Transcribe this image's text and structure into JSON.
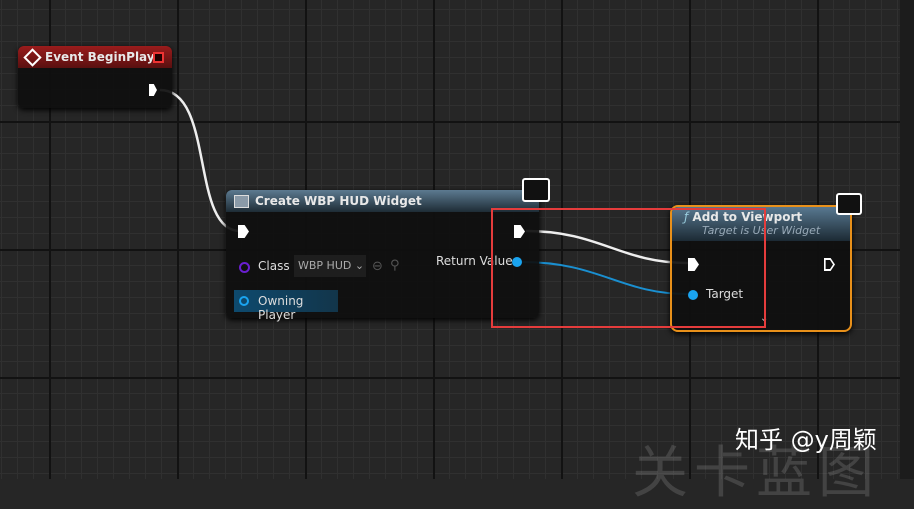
{
  "nodes": {
    "begin_play": {
      "title": "Event BeginPlay"
    },
    "create_widget": {
      "title": "Create WBP HUD Widget",
      "class_label": "Class",
      "class_value": "WBP HUD",
      "owning_player": "Owning Player",
      "return_value": "Return Value"
    },
    "add_viewport": {
      "title": "Add to Viewport",
      "subtitle": "Target is User Widget",
      "target": "Target"
    }
  },
  "watermark": {
    "text": "知乎 @y周颖",
    "background_text": "关卡蓝图"
  },
  "colors": {
    "event_header": "#8c1a1a",
    "function_header": "#3d5a6e",
    "object_pin": "#1aa4f0",
    "class_pin": "#6a1fd0",
    "highlight": "#e53c3c",
    "selected_border": "#e8901a"
  }
}
